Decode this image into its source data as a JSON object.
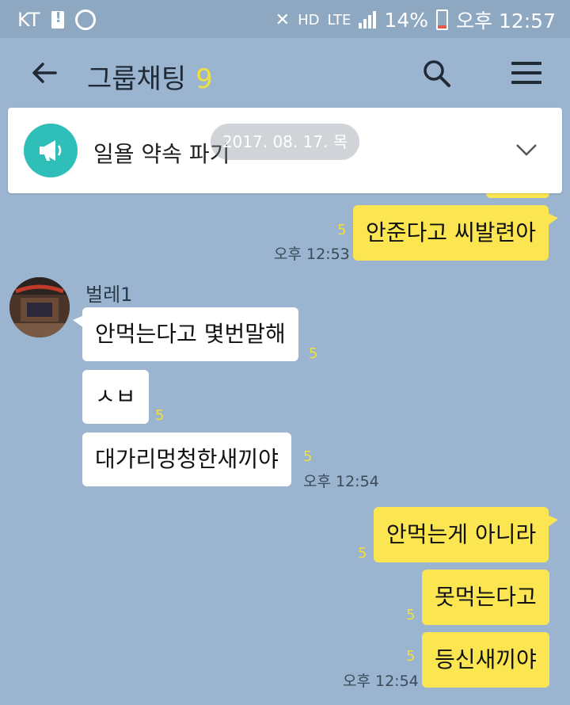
{
  "status": {
    "carrier": "KT",
    "hd": "HD",
    "lte": "LTE",
    "battery": "14%",
    "time": "오후 12:57"
  },
  "header": {
    "title": "그룹채팅",
    "member_count": "9"
  },
  "notice": {
    "text": "일욜 약속 파기",
    "date_badge": "2017. 08. 17. 목"
  },
  "messages": [
    {
      "side": "right",
      "text": "안준다고 씨발련아",
      "unread": "5",
      "time": "오후 12:53"
    },
    {
      "side": "left",
      "sender": "벌레1",
      "text": "안먹는다고 몇번말해",
      "unread": "5"
    },
    {
      "side": "left",
      "text": "ㅅㅂ",
      "unread": "5"
    },
    {
      "side": "left",
      "text": "대가리멍청한새끼야",
      "unread": "5",
      "time": "오후 12:54"
    },
    {
      "side": "right",
      "text": "안먹는게 아니라",
      "unread": "5"
    },
    {
      "side": "right",
      "text": "못먹는다고",
      "unread": "5"
    },
    {
      "side": "right",
      "text": "등신새끼야",
      "unread": "5",
      "time": "오후 12:54"
    }
  ],
  "colors": {
    "background": "#9bb4cf",
    "my_bubble": "#fbe651",
    "their_bubble": "#ffffff",
    "notice_icon": "#2fbfb8"
  }
}
